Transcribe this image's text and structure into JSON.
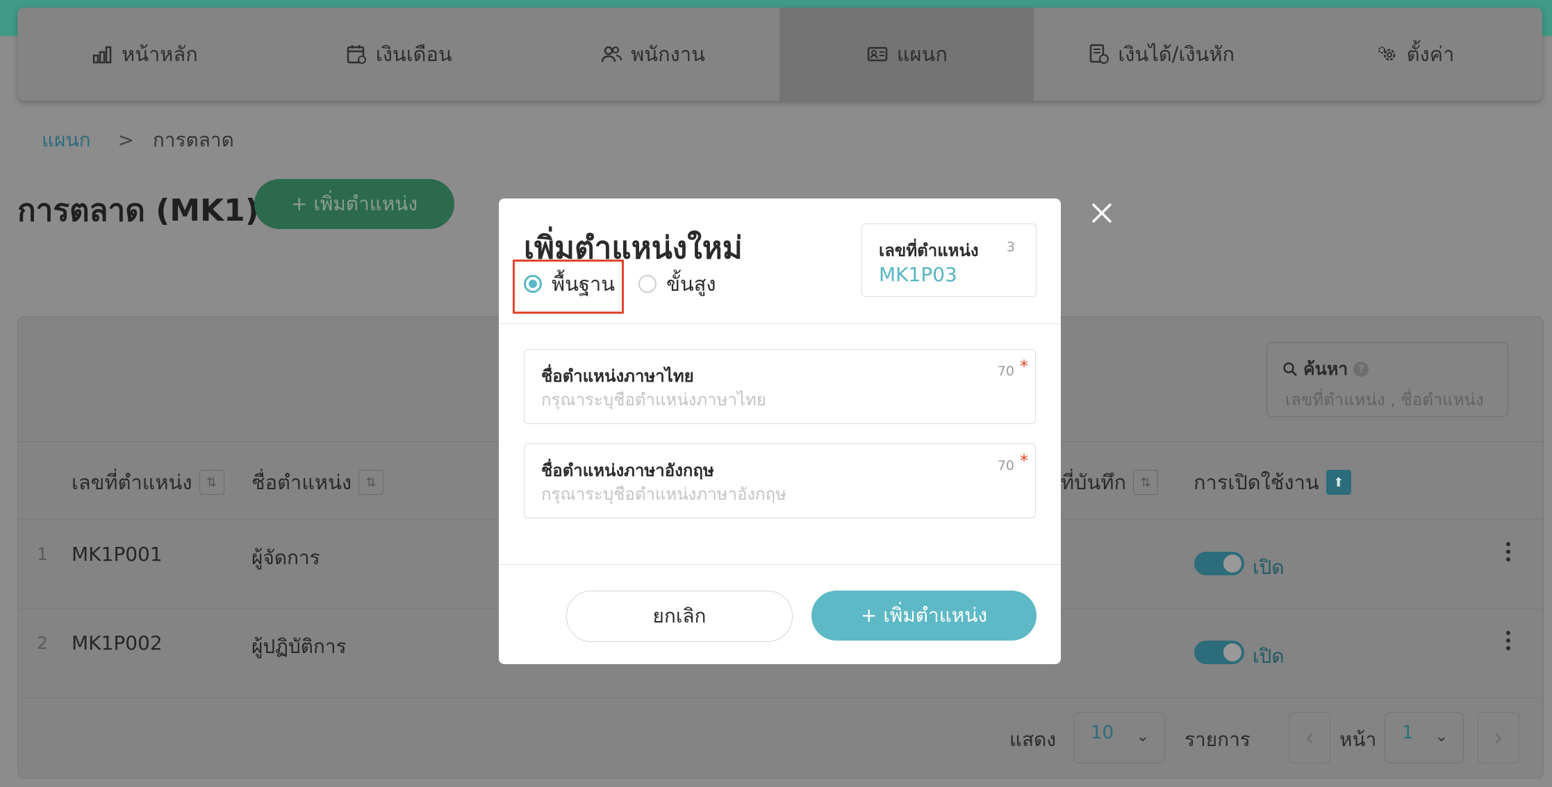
{
  "nav": {
    "items": [
      {
        "label": "หน้าหลัก",
        "icon": "bar-chart-icon"
      },
      {
        "label": "เงินเดือน",
        "icon": "calendar-money-icon"
      },
      {
        "label": "พนักงาน",
        "icon": "users-icon"
      },
      {
        "label": "แผนก",
        "icon": "id-card-icon"
      },
      {
        "label": "เงินได้/เงินหัก",
        "icon": "document-money-icon"
      },
      {
        "label": "ตั้งค่า",
        "icon": "gears-icon"
      }
    ],
    "active": "แผนก"
  },
  "breadcrumb": {
    "parent": "แผนก",
    "separator": ">",
    "current": "การตลาด"
  },
  "page": {
    "title": "การตลาด (MK1)",
    "add_button": "+ เพิ่มตำแหน่ง"
  },
  "search": {
    "label": "ค้นหา",
    "placeholder": "เลขที่ตำแหน่ง , ชื่อตำแหน่ง"
  },
  "table": {
    "headers": {
      "position_no": "เลขที่ตำแหน่ง",
      "position_name": "ชื่อตำแหน่ง",
      "saved_date": "ที่บันทึก",
      "enabled": "การเปิดใช้งาน"
    },
    "rows": [
      {
        "index": "1",
        "position_no": "MK1P001",
        "position_name": "ผู้จัดการ",
        "status": "เปิด"
      },
      {
        "index": "2",
        "position_no": "MK1P002",
        "position_name": "ผู้ปฏิบัติการ",
        "status": "เปิด"
      }
    ]
  },
  "pagination": {
    "show_label": "แสดง",
    "page_size": "10",
    "items_label": "รายการ",
    "page_label": "หน้า",
    "page": "1"
  },
  "modal": {
    "title": "เพิ่มตำแหน่งใหม่",
    "radio_basic": "พื้นฐาน",
    "radio_advanced": "ขั้นสูง",
    "selected": "พื้นฐาน",
    "position_no_label": "เลขที่ตำแหน่ง",
    "position_no_count": "3",
    "position_no_value": "MK1P03",
    "thai_name_label": "ชื่อตำแหน่งภาษาไทย",
    "thai_name_count": "70",
    "thai_name_placeholder": "กรุณาระบุชื่อตำแหน่งภาษาไทย",
    "eng_name_label": "ชื่อตำแหน่งภาษาอังกฤษ",
    "eng_name_count": "70",
    "eng_name_placeholder": "กรุณาระบุชื่อตำแหน่งภาษาอังกฤษ",
    "required_mark": "*",
    "cancel_button": "ยกเลิก",
    "add_button": "+ เพิ่มตำแหน่ง"
  },
  "colors": {
    "accent": "#5cb9c5",
    "brand_green": "#3f9a86",
    "highlight": "#e0452d"
  }
}
